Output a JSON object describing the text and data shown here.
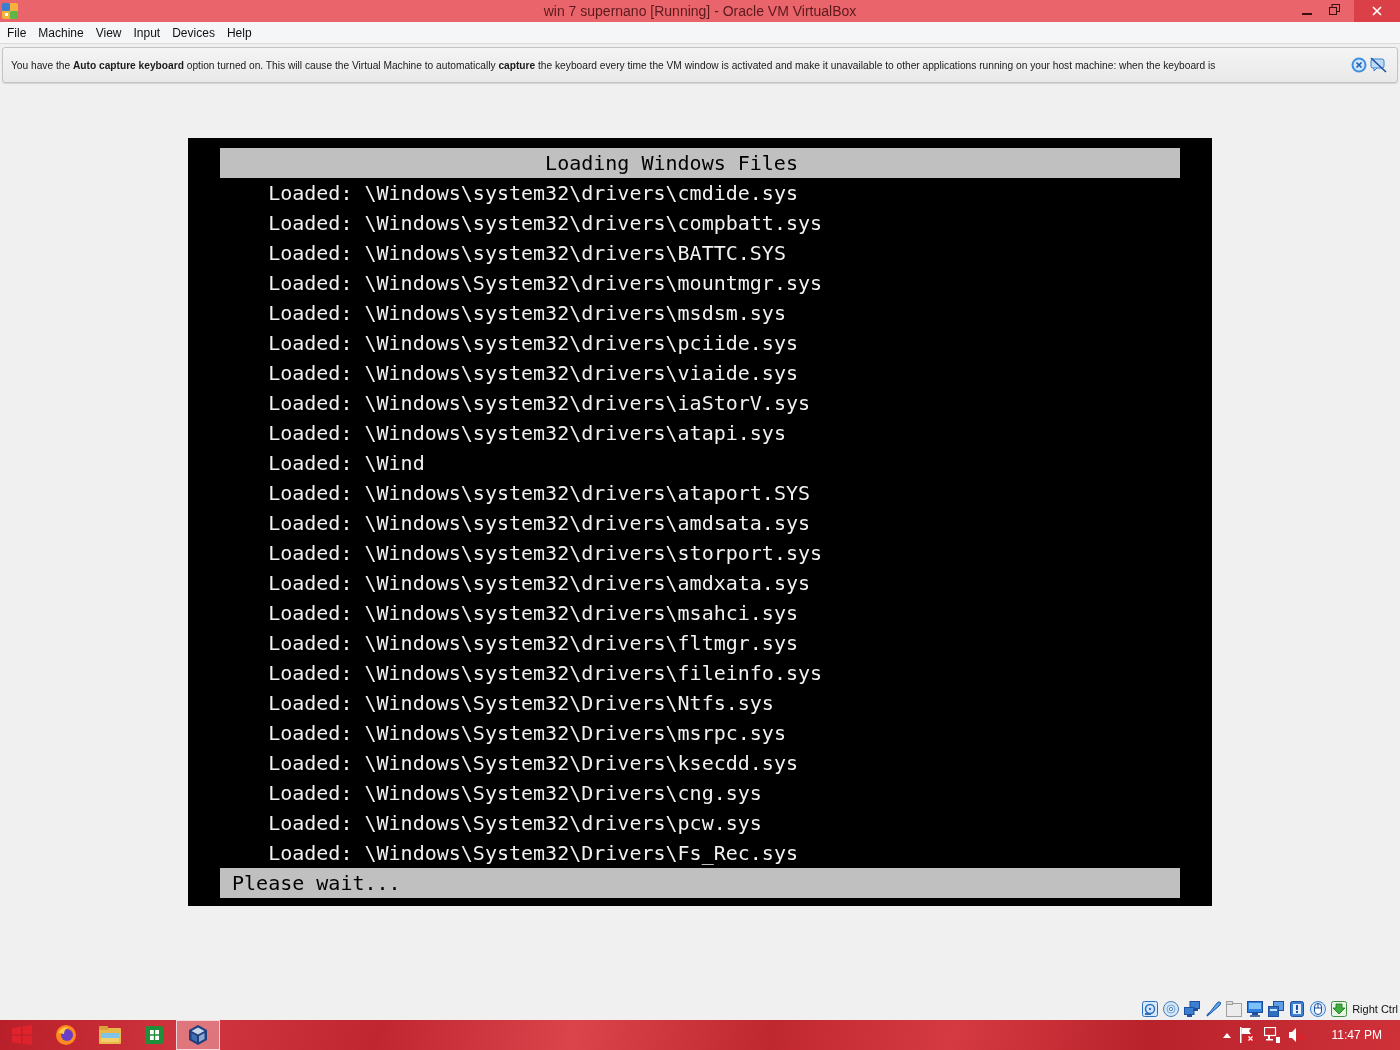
{
  "window": {
    "title": "win 7 supernano [Running] - Oracle VM VirtualBox"
  },
  "menu": [
    "File",
    "Machine",
    "View",
    "Input",
    "Devices",
    "Help"
  ],
  "notification": {
    "text": "You have the **Auto capture keyboard** option turned on. This will cause the Virtual Machine to automatically **capture** the keyboard every time the VM window is activated and make it unavailable to other applications running on your host machine: when the keyboard is"
  },
  "vm_screen": {
    "header": "Loading Windows Files",
    "lines": [
      "Loaded: \\Windows\\system32\\drivers\\cmdide.sys",
      "Loaded: \\Windows\\system32\\drivers\\compbatt.sys",
      "Loaded: \\Windows\\system32\\drivers\\BATTC.SYS",
      "Loaded: \\Windows\\System32\\drivers\\mountmgr.sys",
      "Loaded: \\Windows\\system32\\drivers\\msdsm.sys",
      "Loaded: \\Windows\\system32\\drivers\\pciide.sys",
      "Loaded: \\Windows\\system32\\drivers\\viaide.sys",
      "Loaded: \\Windows\\system32\\drivers\\iaStorV.sys",
      "Loaded: \\Windows\\system32\\drivers\\atapi.sys",
      "Loaded: \\Wind",
      "Loaded: \\Windows\\system32\\drivers\\ataport.SYS",
      "Loaded: \\Windows\\system32\\drivers\\amdsata.sys",
      "Loaded: \\Windows\\system32\\drivers\\storport.sys",
      "Loaded: \\Windows\\system32\\drivers\\amdxata.sys",
      "Loaded: \\Windows\\system32\\drivers\\msahci.sys",
      "Loaded: \\Windows\\system32\\drivers\\fltmgr.sys",
      "Loaded: \\Windows\\system32\\drivers\\fileinfo.sys",
      "Loaded: \\Windows\\System32\\Drivers\\Ntfs.sys",
      "Loaded: \\Windows\\System32\\Drivers\\msrpc.sys",
      "Loaded: \\Windows\\System32\\Drivers\\ksecdd.sys",
      "Loaded: \\Windows\\System32\\Drivers\\cng.sys",
      "Loaded: \\Windows\\System32\\drivers\\pcw.sys",
      "Loaded: \\Windows\\System32\\Drivers\\Fs_Rec.sys"
    ],
    "footer": "Please wait..."
  },
  "status_bar": {
    "host_key": "Right Ctrl"
  },
  "taskbar": {
    "items": [
      {
        "kind": "start",
        "selected": false
      },
      {
        "kind": "browser",
        "selected": false
      },
      {
        "kind": "folder",
        "selected": false
      },
      {
        "kind": "spreadsheet",
        "selected": false
      },
      {
        "kind": "vm",
        "selected": true
      }
    ],
    "clock": "11:47 PM"
  }
}
